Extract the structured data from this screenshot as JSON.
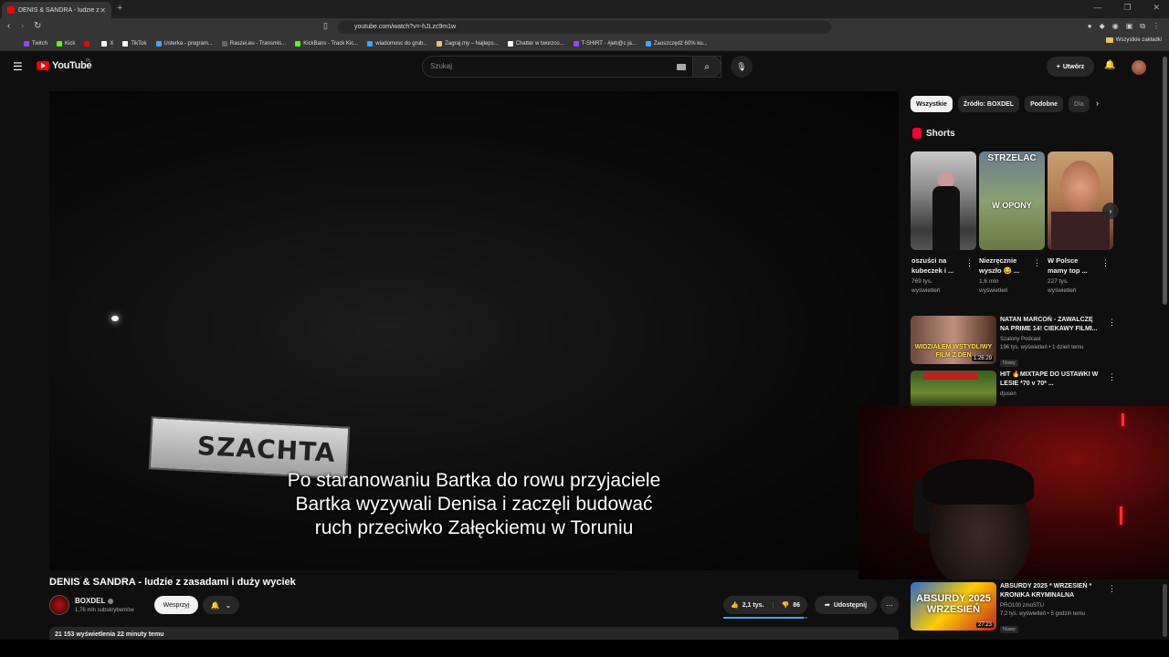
{
  "browser": {
    "tab_title": "DENIS & SANDRA - ludzie z z...",
    "url": "youtube.com/watch?v=-hJLzc9m1w",
    "bookmarks": [
      {
        "label": "Twitch",
        "color": "#9146ff"
      },
      {
        "label": "Kick",
        "color": "#53fc18"
      },
      {
        "label": "",
        "color": "#ff0000"
      },
      {
        "label": "X",
        "color": "#ffffff"
      },
      {
        "label": "TikTok",
        "color": "#ffffff"
      },
      {
        "label": "Usterka - program...",
        "color": "#3ea6ff"
      },
      {
        "label": "Raszei.eu - Transmis...",
        "color": "#666666"
      },
      {
        "label": "KickBans - Track Kic...",
        "color": "#53fc18"
      },
      {
        "label": "wiadomosc do grub...",
        "color": "#3ea6ff"
      },
      {
        "label": "Zagraj.my – Najleps...",
        "color": "#e8c46a"
      },
      {
        "label": "Chatter w tworzco...",
        "color": "#ffffff"
      },
      {
        "label": "T-SHIRT - #jeb@c ja...",
        "color": "#9146ff"
      },
      {
        "label": "Zaoszczędź 60% ku...",
        "color": "#3ea6ff"
      }
    ],
    "all_bookmarks": "Wszystkie zakładki"
  },
  "youtube": {
    "logo_text": "YouTube",
    "country_code": "PL",
    "search_placeholder": "Szukaj",
    "create_label": "Utwórz"
  },
  "video": {
    "sign_text": "SZACHTA",
    "subtitle_lines": [
      "Po staranowaniu Bartka do rowu przyjaciele",
      "Bartka wyzywali Denisa i zaczęli budować",
      "ruch przeciwko Załęckiemu w Toruniu"
    ],
    "title": "DENIS & SANDRA - ludzie z zasadami i duży wyciek",
    "channel_name": "BOXDEL",
    "channel_subs": "1,76 mln subskrybentów",
    "support_label": "Wesprzyj",
    "likes": "2,1 tys.",
    "dislikes": "86",
    "like_ratio": 0.96,
    "share_label": "Udostępnij",
    "description_preview": "21 153 wyświetlenia  22 minuty temu"
  },
  "sidebar": {
    "chips": [
      "Wszystkie",
      "Źródło: BOXDEL",
      "Podobne",
      "Dla"
    ],
    "shorts_heading": "Shorts",
    "shorts": [
      {
        "title_line1": "oszuści na",
        "title_line2": "kubeczek i ...",
        "views_line1": "769 tys.",
        "views_line2": "wyświetleń",
        "overlay_top": "",
        "overlay_mid": ""
      },
      {
        "title_line1": "Niezręcznie",
        "title_line2": "wyszło 😂 ...",
        "views_line1": "1,6 mln",
        "views_line2": "wyświetleń",
        "overlay_top": "STRZELAC",
        "overlay_mid": "W OPONY"
      },
      {
        "title_line1": "W Polsce",
        "title_line2": "mamy top ...",
        "views_line1": "227 tys.",
        "views_line2": "wyświetleń",
        "overlay_top": "",
        "overlay_mid": ""
      }
    ],
    "recommendations": [
      {
        "title": "NATAN MARCOŃ - ZAWALCZĘ NA PRIME 14! CIEKAWY FILMI...",
        "channel": "Szalony Podcast",
        "meta": "196 tys. wyświetleń • 1 dzień temu",
        "badge": "Nowy",
        "thumb_text": "WIDZIAŁEM WSTYDLIWY FILM Z DEN",
        "duration": "1:26:29"
      },
      {
        "title": "HIT 🔥MIXTAPE DO USTAWKI W LESIE *70 v 70* ...",
        "channel": "djusen",
        "meta": "",
        "badge": "",
        "thumb_text": "",
        "duration": ""
      },
      {
        "title": "ABSURDY 2025 * WRZESIEŃ * KRONIKA KRYMINALNA",
        "channel": "PRO100 zmoSTU",
        "meta": "7,2 tys. wyświetleń • 5 godzin temu",
        "badge": "Nowy",
        "thumb_text": "ABSURDY 2025 WRZESIEŃ",
        "duration": "27:23"
      }
    ]
  }
}
